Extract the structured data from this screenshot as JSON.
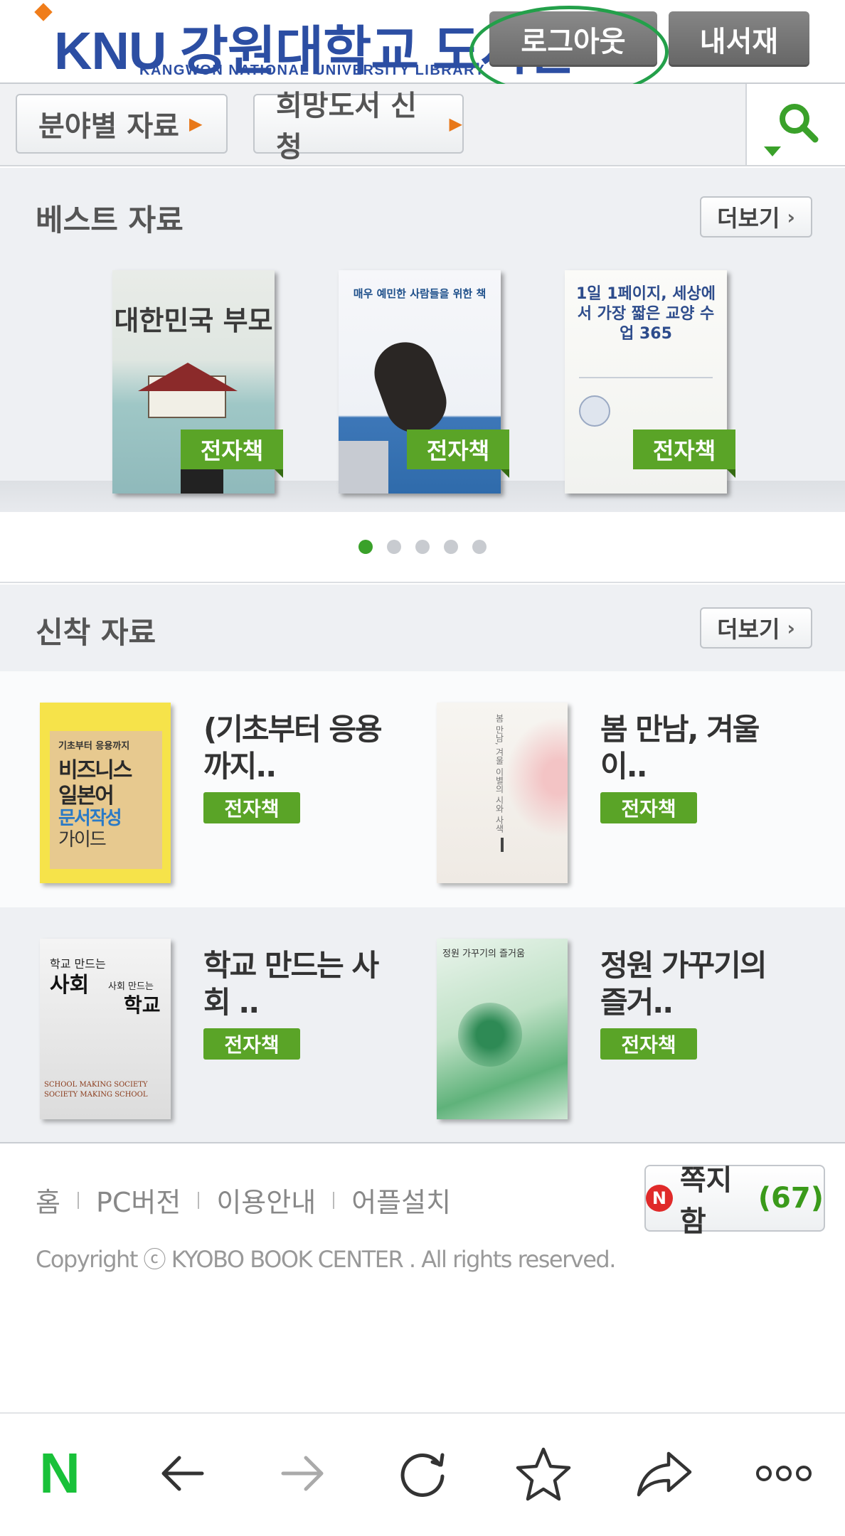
{
  "header": {
    "logo_text": "KNU 강원대학교 도서관",
    "logo_subtitle": "KANGWON NATIONAL UNIVERSITY LIBRARY",
    "logout_label": "로그아웃",
    "mylibrary_label": "내서재"
  },
  "menu": {
    "field_label": "분야별 자료",
    "hope_label": "희망도서 신청",
    "search_icon": "search-icon"
  },
  "best": {
    "title": "베스트 자료",
    "more_label": "더보기",
    "books": [
      {
        "cover_title": "대한민국 부모",
        "tag": "전자책"
      },
      {
        "cover_title": "매우 예민한 사람들을 위한 책",
        "tag": "전자책"
      },
      {
        "cover_title": "1일 1페이지, 세상에서 가장 짧은 교양 수업 365",
        "tag": "전자책"
      }
    ],
    "page_count": 5,
    "active_page": 1
  },
  "new": {
    "title": "신착 자료",
    "more_label": "더보기",
    "books": [
      {
        "title": "(기초부터 응용까지..",
        "tag": "전자책",
        "cover_lines": [
          "기초부터 응용까지",
          "비즈니스",
          "일본어",
          "문서작성",
          "가이드"
        ]
      },
      {
        "title": "봄 만남, 겨울 이..",
        "tag": "전자책",
        "cover_lines": [
          "봄 만남, 겨울 이별의 시와 사색"
        ]
      },
      {
        "title": "학교 만드는 사회 ..",
        "tag": "전자책",
        "cover_lines": [
          "학교 만드는",
          "사회",
          "사회 만드는",
          "학교",
          "SCHOOL MAKING SOCIETY",
          "SOCIETY MAKING SCHOOL"
        ]
      },
      {
        "title": "정원 가꾸기의 즐거..",
        "tag": "전자책",
        "cover_lines": [
          "정원 가꾸기의 즐거움"
        ]
      }
    ]
  },
  "footer": {
    "links": [
      "홈",
      "PC버전",
      "이용안내",
      "어플설치"
    ],
    "copyright": "Copyright ⓒ KYOBO BOOK CENTER . All rights reserved.",
    "memo_label": "쪽지함",
    "memo_count": "(67)",
    "memo_badge": "N"
  },
  "browser_nav": {
    "items": [
      "naver-home-icon",
      "back-arrow-icon",
      "forward-arrow-icon",
      "refresh-icon",
      "bookmark-star-icon",
      "share-icon",
      "more-dots-icon"
    ],
    "home_letter": "N"
  },
  "colors": {
    "brand_blue": "#2c4ea3",
    "ebook_green": "#5aa427",
    "highlight_green": "#23a04a",
    "naver_green": "#19c139"
  }
}
